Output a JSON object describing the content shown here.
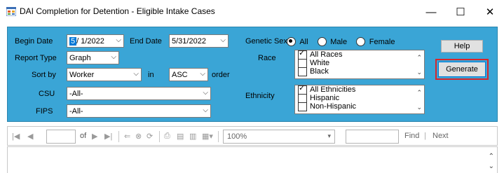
{
  "window": {
    "title": "DAI Completion for Detention - Eligible Intake Cases",
    "minimize": "—",
    "maximize": "☐",
    "close": "✕"
  },
  "form": {
    "begin_date_label": "Begin Date",
    "begin_date_month": "5",
    "begin_date_rest": "/ 1/2022",
    "end_date_label": "End Date",
    "end_date_value": "5/31/2022",
    "genetic_sex_label": "Genetic Sex",
    "sex_options": [
      "All",
      "Male",
      "Female"
    ],
    "sex_selected": "All",
    "help_label": "Help",
    "generate_label": "Generate",
    "report_type_label": "Report Type",
    "report_type_value": "Graph",
    "race_label": "Race",
    "race_items": [
      "All Races",
      "White",
      "Black"
    ],
    "race_checked": [
      "All Races"
    ],
    "sort_by_label": "Sort by",
    "sort_by_value": "Worker",
    "in_label": "in",
    "order_value": "ASC",
    "order_label": "order",
    "csu_label": "CSU",
    "csu_value": "-All-",
    "fips_label": "FIPS",
    "fips_value": "-All-",
    "ethnicity_label": "Ethnicity",
    "ethnicity_items": [
      "All Ethnicities",
      "Hispanic",
      "Non-Hispanic"
    ],
    "ethnicity_checked": [
      "All Ethnicities"
    ]
  },
  "toolbar": {
    "of_label": "of",
    "zoom_value": "100%",
    "find_label": "Find",
    "separator": "|",
    "next_label": "Next"
  },
  "colors": {
    "panel_bg": "#3aa5d6",
    "generate_highlight": "#d8262b",
    "selection": "#0078d7"
  }
}
